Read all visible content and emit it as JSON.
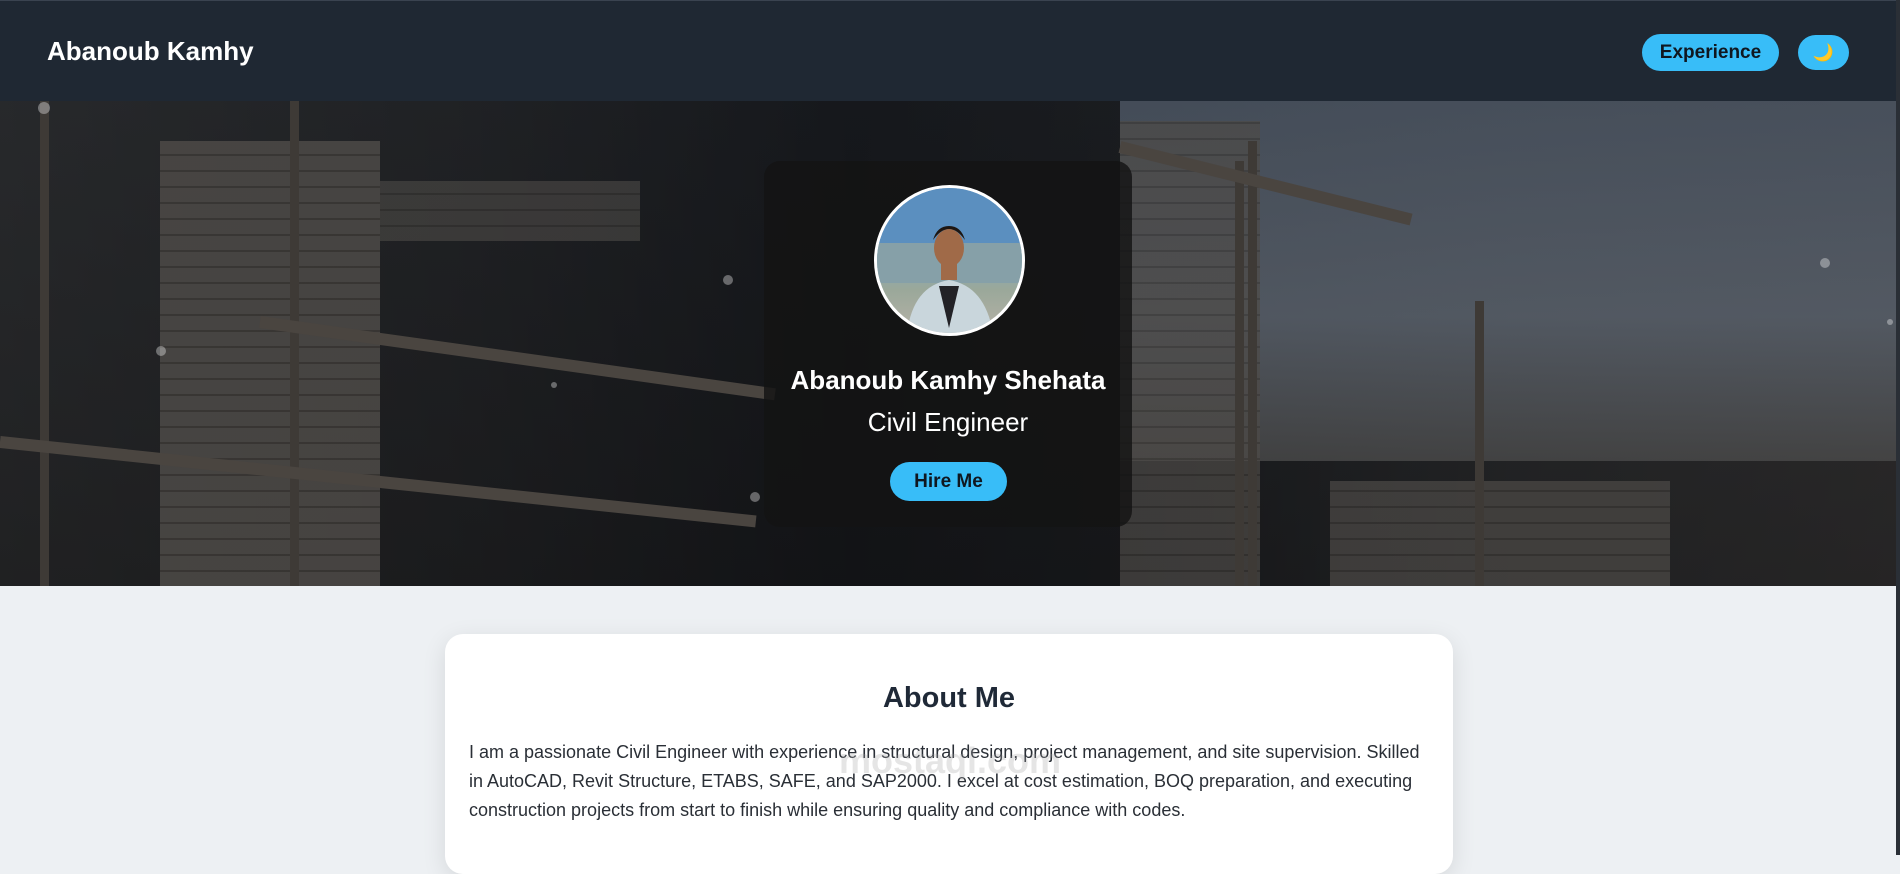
{
  "nav": {
    "brand": "Abanoub Kamhy",
    "experience_label": "Experience",
    "theme_toggle_glyph": "🌙"
  },
  "hero": {
    "name": "Abanoub Kamhy Shehata",
    "role": "Civil Engineer",
    "cta_label": "Hire Me"
  },
  "about": {
    "title": "About Me",
    "text": "I am a passionate Civil Engineer with experience in structural design, project management, and site supervision. Skilled in AutoCAD, Revit Structure, ETABS, SAFE, and SAP2000. I excel at cost estimation, BOQ preparation, and executing construction projects from start to finish while ensuring quality and compliance with codes."
  },
  "watermark": "mostaql.com",
  "colors": {
    "accent": "#38bdf8",
    "navbar": "#1f2833",
    "page_bg": "#edf0f3"
  }
}
